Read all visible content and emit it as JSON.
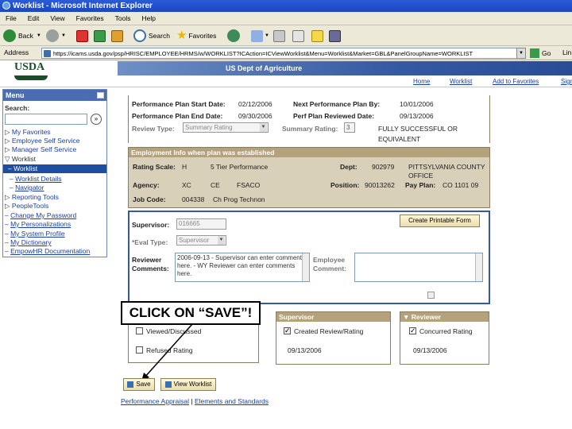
{
  "window": {
    "title": "Worklist - Microsoft Internet Explorer"
  },
  "menubar": [
    "File",
    "Edit",
    "View",
    "Favorites",
    "Tools",
    "Help"
  ],
  "toolbar": {
    "back": "Back",
    "search": "Search",
    "favorites": "Favorites"
  },
  "address": {
    "label": "Address",
    "url": "https://icams.usda.gov/psp/HRISC/EMPLOYEE/HRMS/w/WORKLIST?ICAction=ICViewWorklist&Menu=Worklist&Market=GBL&PanelGroupName=WORKLIST",
    "go": "Go",
    "links": "Lin"
  },
  "banner": {
    "logo": "USDA",
    "org": "US Dept of Agriculture"
  },
  "nav": {
    "home": "Home",
    "worklist": "Worklist",
    "add_favorites": "Add to Favorites",
    "sign_out": "Sign"
  },
  "menu": {
    "title": "Menu",
    "search_label": "Search:",
    "items": [
      "My Favorites",
      "Employee Self Service",
      "Manager Self Service",
      "Worklist",
      "Worklist",
      "Worklist Details",
      "Navigator",
      "Reporting Tools",
      "PeopleTools",
      "Change My Password",
      "My Personalizations",
      "My System Profile",
      "My Dictionary",
      "EmpowHR Documentation"
    ]
  },
  "plan": {
    "start_label": "Performance Plan Start Date:",
    "start": "02/12/2006",
    "end_label": "Performance Plan End Date:",
    "end": "09/30/2006",
    "next_label": "Next Performance Plan By:",
    "next": "10/01/2006",
    "reviewed_label": "Perf Plan Reviewed Date:",
    "reviewed": "09/13/2006",
    "review_type_label": "Review Type:",
    "review_type": "Summary Rating",
    "summary_label": "Summary Rating:",
    "summary_num": "3",
    "summary_text": "FULLY SUCCESSFUL OR EQUIVALENT"
  },
  "employment": {
    "header": "Employment Info when plan was established",
    "scale_label": "Rating Scale:",
    "scale": "H",
    "scale_desc": "5 Tier Performance",
    "dept_label": "Dept:",
    "dept": "902979",
    "dept_name": "PITTSYLVANIA COUNTY OFFICE",
    "agency_label": "Agency:",
    "agency": "XC",
    "agency2": "CE",
    "agency3": "FSACO",
    "position_label": "Position:",
    "position": "90013262",
    "payplan_label": "Pay Plan:",
    "payplan": "CO 1101 09",
    "jobcode_label": "Job Code:",
    "jobcode": "004338",
    "jobcode_desc": "Ch Prog Technon"
  },
  "supervisor_section": {
    "supervisor_label": "Supervisor:",
    "supervisor": "016665",
    "eval_label": "*Eval Type:",
    "eval": "Supervisor",
    "print_button": "Create Printable Form",
    "reviewer_label": "Reviewer Comments:",
    "reviewer_comments": "2006-09-13 - Supervisor can enter comments here. - WY Reviewer can enter comments here.",
    "employee_label": "Employee Comment:"
  },
  "status": {
    "employee_viewed": "Viewed/Discussed",
    "employee_refused": "Refused Rating",
    "supervisor_header": "Supervisor",
    "supervisor_check": "Created Review/Rating",
    "supervisor_date": "09/13/2006",
    "reviewer_header": "Reviewer",
    "reviewer_check": "Concurred Rating",
    "reviewer_date": "09/13/2006"
  },
  "buttons": {
    "save": "Save",
    "view_worklist": "View Worklist"
  },
  "footer": {
    "appraisal": "Performance Appraisal",
    "sep": " | ",
    "elements": "Elements and Standards"
  },
  "callout": "CLICK ON “SAVE”!"
}
